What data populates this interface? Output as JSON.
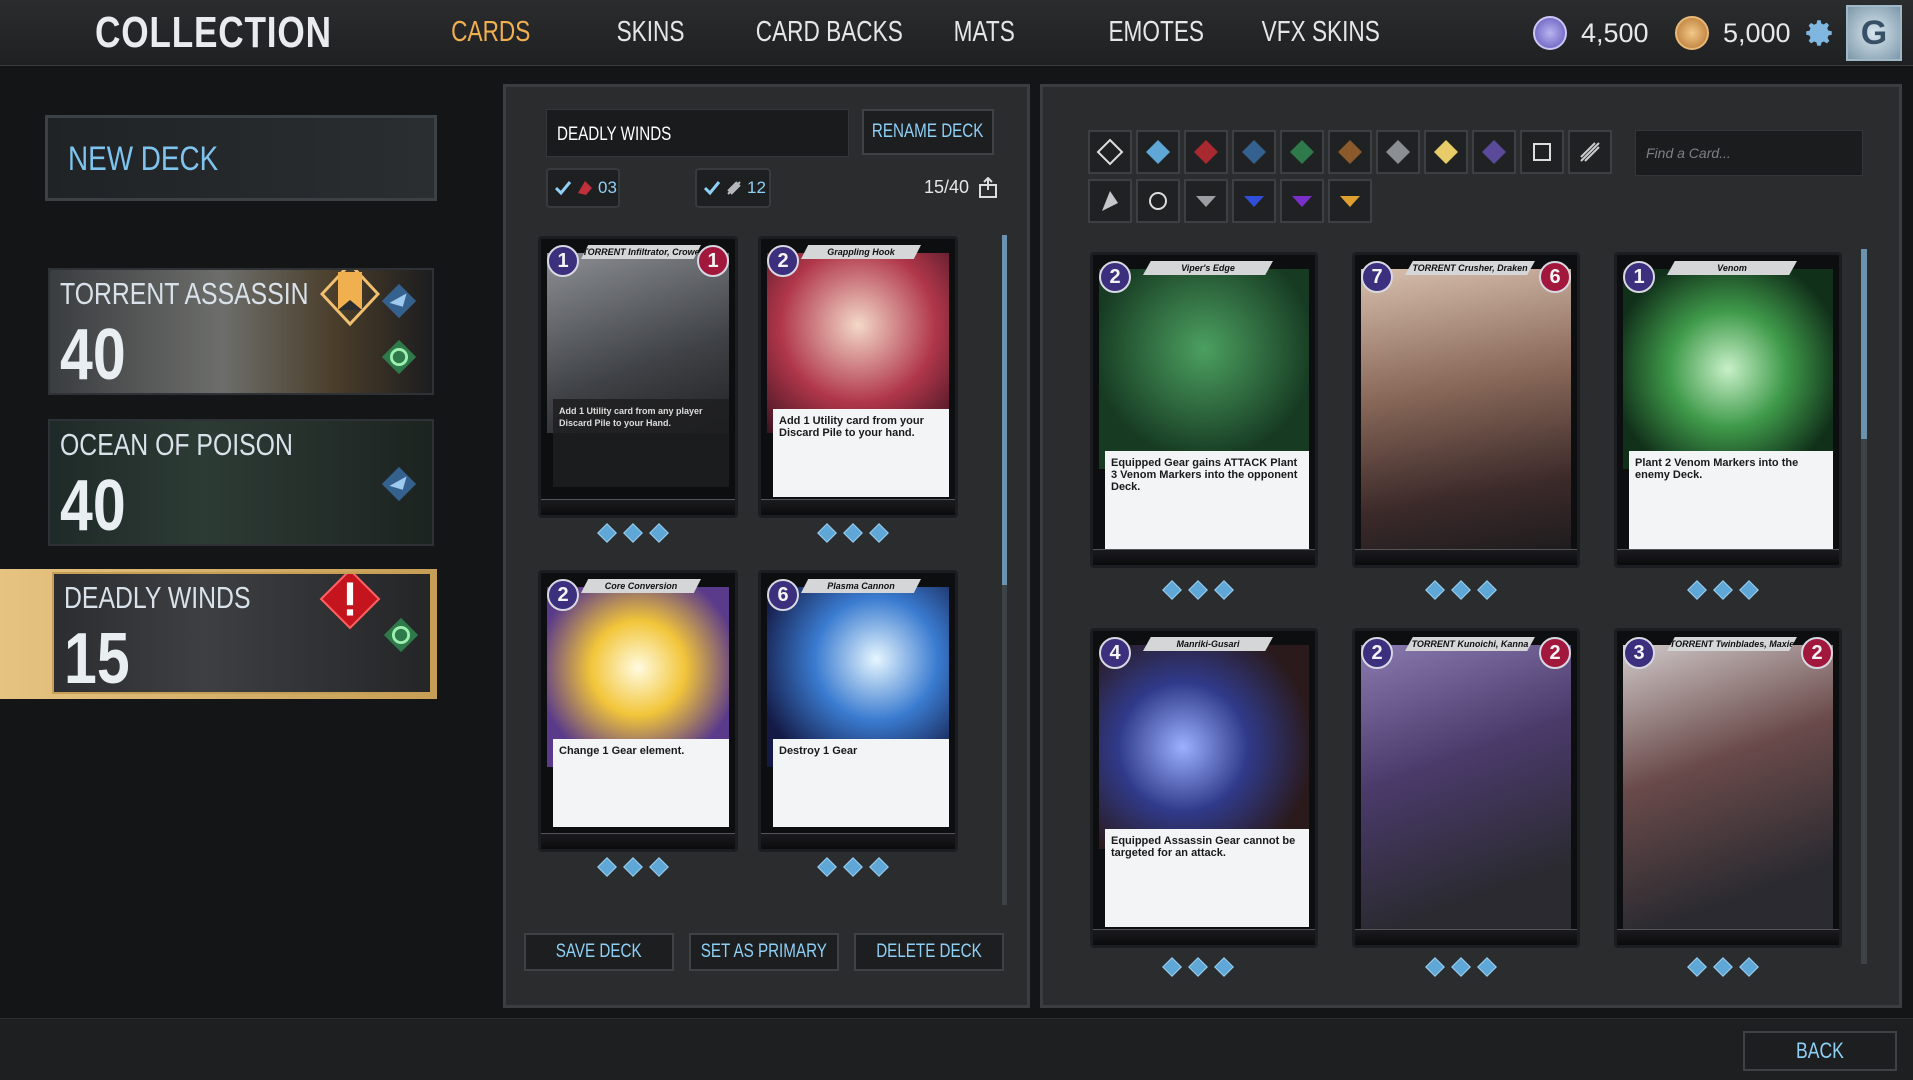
{
  "header": {
    "title": "COLLECTION",
    "tabs": [
      {
        "label": "CARDS",
        "active": true
      },
      {
        "label": "SKINS",
        "active": false
      },
      {
        "label": "CARD BACKS",
        "active": false
      },
      {
        "label": "MATS",
        "active": false
      },
      {
        "label": "EMOTES",
        "active": false
      },
      {
        "label": "VFX SKINS",
        "active": false
      }
    ],
    "currency_a": "4,500",
    "currency_b": "5,000",
    "avatar_letter": "G"
  },
  "sidebar": {
    "new_deck": "NEW DECK",
    "decks": [
      {
        "name": "TORRENT ASSASSIN",
        "count": "40"
      },
      {
        "name": "OCEAN OF POISON",
        "count": "40"
      },
      {
        "name": "DEADLY WINDS",
        "count": "15"
      }
    ]
  },
  "editor": {
    "deck_name": "DEADLY WINDS",
    "rename": "RENAME DECK",
    "stat_a": "03",
    "stat_b": "12",
    "deck_count": "15/40",
    "save": "SAVE DECK",
    "primary": "SET AS PRIMARY",
    "delete": "DELETE DECK"
  },
  "deck_cards": [
    {
      "name": "TORRENT Infiltrator, Crowe",
      "cost": "1",
      "atk": "1",
      "text": "Add 1 Utility card from any player Discard Pile to your Hand."
    },
    {
      "name": "Grappling Hook",
      "cost": "2",
      "atk": "",
      "text": "Add 1 Utility card from your Discard Pile to your hand."
    },
    {
      "name": "Core Conversion",
      "cost": "2",
      "atk": "",
      "text": "Change 1 Gear element."
    },
    {
      "name": "Plasma Cannon",
      "cost": "6",
      "atk": "",
      "text": "Destroy 1 Gear"
    }
  ],
  "library": {
    "search_placeholder": "Find a Card...",
    "cards": [
      {
        "name": "Viper's Edge",
        "cost": "2",
        "atk": "",
        "text": "Equipped Gear gains ATTACK Plant 3 Venom Markers into the opponent Deck."
      },
      {
        "name": "TORRENT Crusher, Draken",
        "cost": "7",
        "atk": "6",
        "text": ""
      },
      {
        "name": "Venom",
        "cost": "1",
        "atk": "",
        "text": "Plant 2 Venom Markers into the enemy Deck."
      },
      {
        "name": "Manriki-Gusari",
        "cost": "4",
        "atk": "",
        "text": "Equipped Assassin Gear cannot be targeted for an attack."
      },
      {
        "name": "TORRENT Kunoichi, Kanna",
        "cost": "2",
        "atk": "2",
        "text": ""
      },
      {
        "name": "TORRENT Twinblades, Maxie",
        "cost": "3",
        "atk": "2",
        "text": ""
      }
    ]
  },
  "footer": {
    "back": "BACK"
  },
  "colors": {
    "accent": "#f0b050",
    "blue": "#8fd0f6",
    "cost": "#3b2f7e",
    "atk": "#a2183d"
  }
}
